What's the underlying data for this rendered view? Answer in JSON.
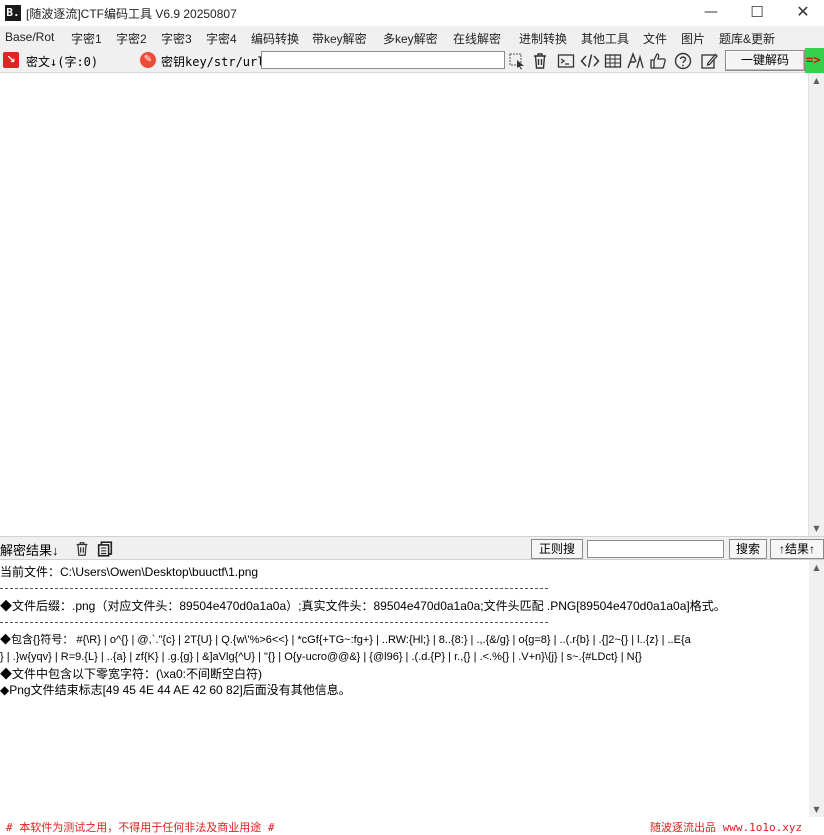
{
  "window": {
    "title": "[随波逐流]CTF编码工具 V6.9  20250807",
    "app_icon": "B.",
    "controls": {
      "minimize": "—",
      "maximize": "☐",
      "close": "✕"
    }
  },
  "menu": [
    "Base/Rot",
    "字密1",
    "字密2",
    "字密3",
    "字密4",
    "编码转换",
    "带key解密",
    "多key解密",
    "在线解密",
    "进制转换",
    "其他工具",
    "文件",
    "图片",
    "题库&更新"
  ],
  "toolbar": {
    "cipher_label": "密文↓(字:0)",
    "key_label": "密钥key/str/url:",
    "key_value": "",
    "icons": [
      "cursor-icon",
      "trash-icon",
      "terminal-icon",
      "code-icon",
      "keyboard-icon",
      "font-icon",
      "thumbs-up-icon",
      "help-icon",
      "edit-icon"
    ],
    "decode_button": "一键解码",
    "extra_label": "=>"
  },
  "input": {
    "text": ""
  },
  "result_bar": {
    "label": "解密结果↓",
    "regex_button": "正则搜",
    "search_value": "",
    "search_button": "搜索",
    "toggle_button": "↑结果↑"
  },
  "result": {
    "current_file": "当前文件：C:\\Users\\Owen\\Desktop\\buuctf\\1.png",
    "file_suffix": "◆文件后缀：.png（对应文件头：89504e470d0a1a0a）;真实文件头：89504e470d0a1a0a;文件头匹配 .PNG[89504e470d0a1a0a]格式。",
    "braces_line1": "◆包含{}符号： #{\\R} | o^{} | @,`.\"{c} | 2T{U} | Q.{w\\'%>6<<} | *cGf{+TG~:fg+} | ..RW:{Hl;} | 8..{8:} | .,.{&/g} | o{g=8} | ..(.r{b} | .{]2~{} | l..{z} | ..E{a",
    "braces_line2": "} | .}w{yqv} | R=9.{L} | ..{a} | zf{K} | .g.{g} | &]aVlg{^U} | \"{} | O{y-ucro@@&} | {@l96} | .(.d.{P} | r.,{} | .<.%{} | .V+n}\\{j} | s~.{#LDct} | N{}",
    "zero_width": "◆文件中包含以下零宽字符：(\\xa0:不间断空白符)",
    "png_end": "◆Png文件结束标志[49 45 4E 44 AE 42 60 82]后面没有其他信息。"
  },
  "footer": {
    "left": "# 本软件为测试之用，不得用于任何非法及商业用途 #",
    "right": "随波逐流出品 www.1o1o.xyz"
  },
  "colors": {
    "accent_red": "#e02020",
    "green": "#33d24a"
  }
}
